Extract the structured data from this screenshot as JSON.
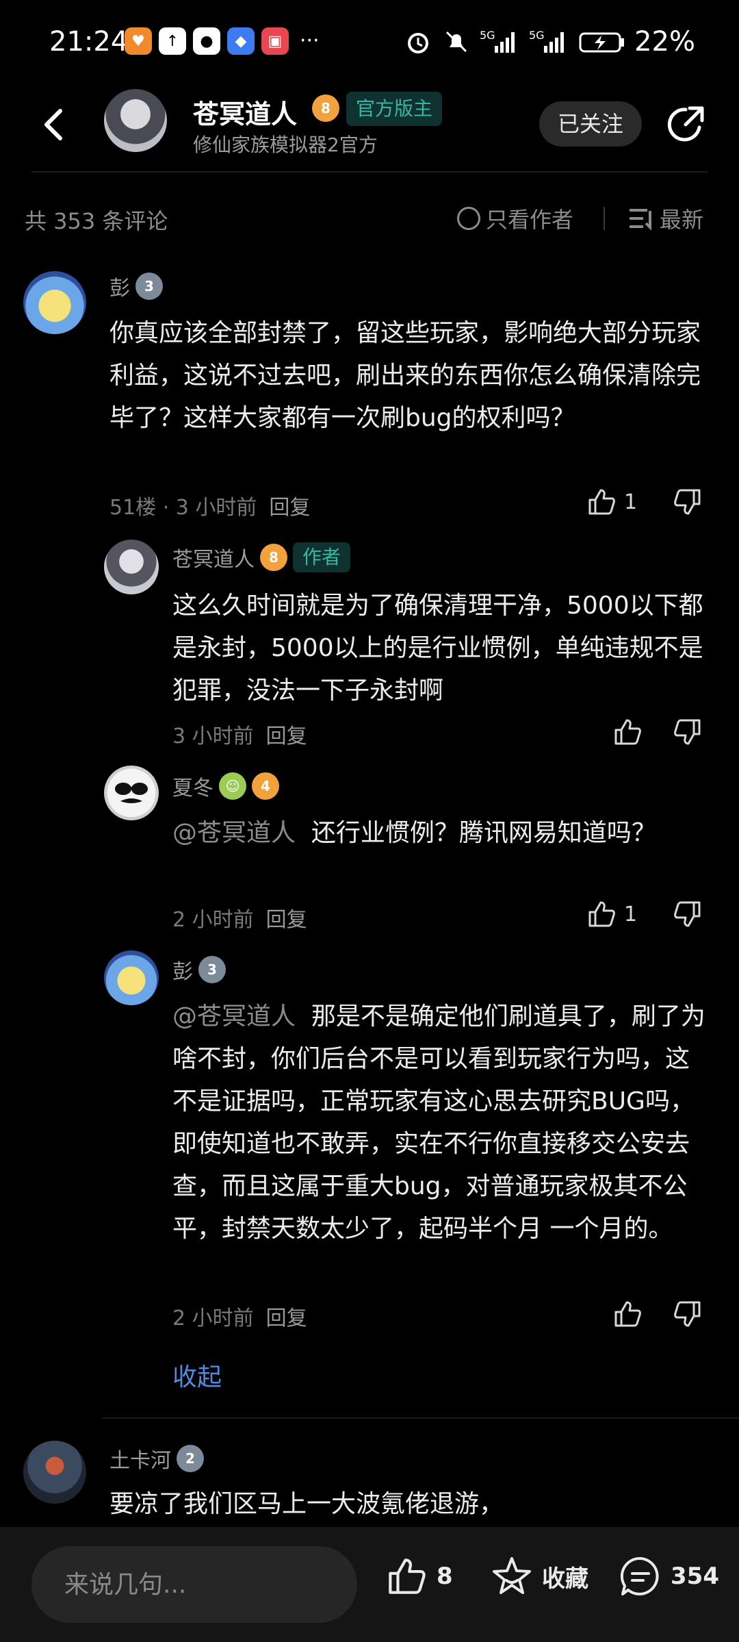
{
  "status_bar": {
    "time": "21:24",
    "battery": "22%",
    "network_1": "5G",
    "network_2": "5G"
  },
  "header": {
    "name": "苍冥道人",
    "level": "8",
    "official_tag": "官方版主",
    "subtitle": "修仙家族模拟器2官方",
    "follow_label": "已关注"
  },
  "toolbar": {
    "count_text": "共 353 条评论",
    "only_author": "只看作者",
    "sort": "最新"
  },
  "comments": [
    {
      "name": "彭",
      "level": "3",
      "text": "你真应该全部封禁了，留这些玩家，影响绝大部分玩家利益，这说不过去吧，刷出来的东西你怎么确保清除完毕了？这样大家都有一次刷bug的权利吗？",
      "meta": "51楼 · 3 小时前",
      "reply": "回复",
      "likes": "1"
    },
    {
      "name": "苍冥道人",
      "level": "8",
      "author_tag": "作者",
      "text": "这么久时间就是为了确保清理干净，5000以下都是永封，5000以上的是行业惯例，单纯违规不是犯罪，没法一下子永封啊",
      "meta": "3 小时前",
      "reply": "回复",
      "likes": ""
    },
    {
      "name": "夏冬",
      "level": "4",
      "mention": "@苍冥道人",
      "text": "还行业惯例？腾讯网易知道吗？",
      "meta": "2 小时前",
      "reply": "回复",
      "likes": "1"
    },
    {
      "name": "彭",
      "level": "3",
      "mention": "@苍冥道人",
      "text": "那是不是确定他们刷道具了，刷了为啥不封，你们后台不是可以看到玩家行为吗，这不是证据吗，正常玩家有这心思去研究BUG吗，即使知道也不敢弄，实在不行你直接移交公安去查，而且这属于重大bug，对普通玩家极其不公平，封禁天数太少了，起码半个月 一个月的。",
      "meta": "2 小时前",
      "reply": "回复",
      "likes": ""
    },
    {
      "name": "土卡河",
      "level": "2",
      "text": "要凉了我们区马上一大波氪佬退游，"
    }
  ],
  "collapse_label": "收起",
  "bottom_bar": {
    "input_placeholder": "来说几句...",
    "like_count": "8",
    "favorite_label": "收藏",
    "comment_count": "354"
  },
  "icons": [
    "back-icon",
    "share-icon",
    "thumb-up-icon",
    "thumb-down-icon",
    "star-icon",
    "comment-icon",
    "circle-icon",
    "sort-icon"
  ],
  "colors": {
    "background": "#000000",
    "accent_teal": "#37b7a3",
    "link_blue": "#4f8be0",
    "level_orange": "#f2a23a"
  }
}
